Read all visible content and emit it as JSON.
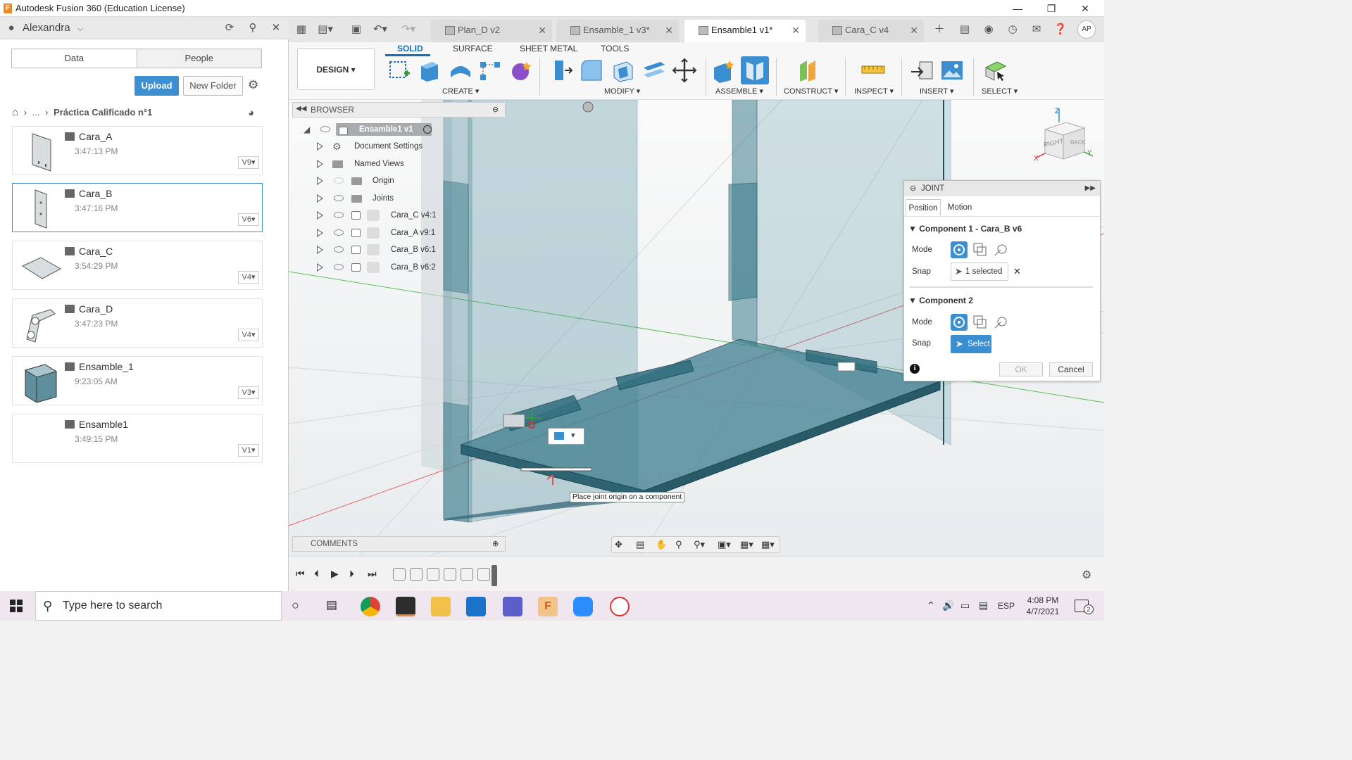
{
  "window": {
    "title": "Autodesk Fusion 360 (Education License)",
    "logo_letter": "F"
  },
  "left_panel": {
    "user": "Alexandra",
    "tabs": [
      "Data",
      "People"
    ],
    "upload_label": "Upload",
    "new_folder_label": "New Folder",
    "breadcrumb": {
      "ellipsis": "...",
      "current": "Práctica Calificado n°1"
    },
    "files": [
      {
        "name": "Cara_A",
        "time": "3:47:13 PM",
        "version": "V9"
      },
      {
        "name": "Cara_B",
        "time": "3:47:16 PM",
        "version": "V6"
      },
      {
        "name": "Cara_C",
        "time": "3:54:29 PM",
        "version": "V4"
      },
      {
        "name": "Cara_D",
        "time": "3:47:23 PM",
        "version": "V4"
      },
      {
        "name": "Ensamble_1",
        "time": "9:23:05 AM",
        "version": "V3"
      },
      {
        "name": "Ensamble1",
        "time": "3:49:15 PM",
        "version": "V1"
      }
    ]
  },
  "doc_tabs": [
    {
      "label": "Plan_D v2"
    },
    {
      "label": "Ensamble_1 v3*"
    },
    {
      "label": "Ensamble1 v1*"
    },
    {
      "label": "Cara_C v4"
    }
  ],
  "avatar_initials": "AP",
  "toolbar": {
    "design_label": "DESIGN",
    "tabs": [
      "SOLID",
      "SURFACE",
      "SHEET METAL",
      "TOOLS"
    ],
    "groups": [
      "CREATE",
      "MODIFY",
      "ASSEMBLE",
      "CONSTRUCT",
      "INSPECT",
      "INSERT",
      "SELECT"
    ]
  },
  "browser": {
    "title": "BROWSER",
    "root": "Ensamble1 v1",
    "items": [
      "Document Settings",
      "Named Views",
      "Origin",
      "Joints",
      "Cara_C v4:1",
      "Cara_A v9:1",
      "Cara_B v6:1",
      "Cara_B v6:2"
    ]
  },
  "joint_dialog": {
    "title": "JOINT",
    "tabs": [
      "Position",
      "Motion"
    ],
    "component1": "Component 1 - Cara_B v6",
    "component2": "Component 2",
    "mode_label": "Mode",
    "snap_label": "Snap",
    "snap1_value": "1 selected",
    "snap2_value": "Select",
    "ok_label": "OK",
    "cancel_label": "Cancel"
  },
  "viewcube": {
    "face_right": "RIGHT",
    "face_back": "BACK"
  },
  "tooltip": "Place joint origin on a component",
  "comments_label": "COMMENTS",
  "taskbar": {
    "search_placeholder": "Type here to search",
    "lang": "ESP",
    "time": "4:08 PM",
    "date": "4/7/2021",
    "notif_count": "2"
  },
  "colors": {
    "accent": "#0d6fbf",
    "upload": "#3d8fd1",
    "model_fill": "#3f7f90"
  }
}
